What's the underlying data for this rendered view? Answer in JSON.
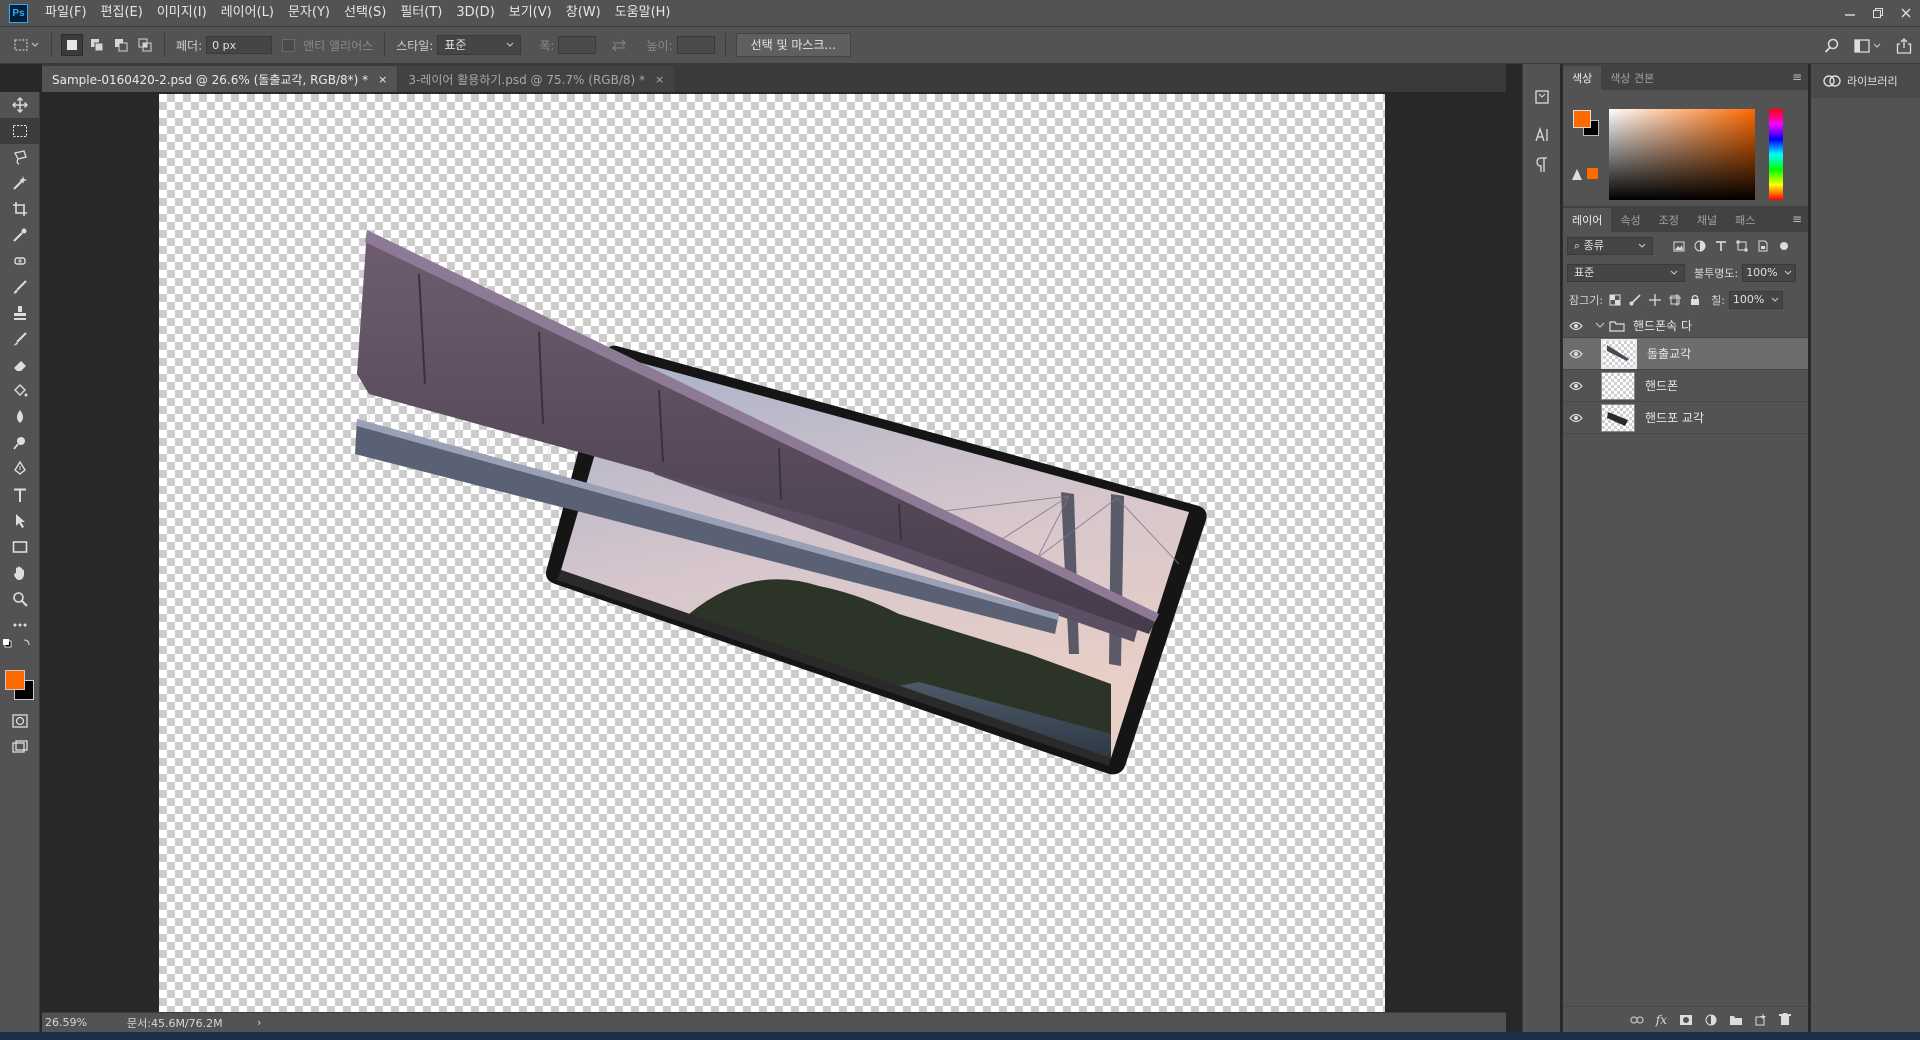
{
  "app": {
    "logo": "Ps"
  },
  "menu": [
    "파일(F)",
    "편집(E)",
    "이미지(I)",
    "레이어(L)",
    "문자(Y)",
    "선택(S)",
    "필터(T)",
    "3D(D)",
    "보기(V)",
    "창(W)",
    "도움말(H)"
  ],
  "options": {
    "feather_label": "페더:",
    "feather_value": "0 px",
    "antialias_label": "앤티 앨리어스",
    "style_label": "스타일:",
    "style_value": "표준",
    "width_label": "폭:",
    "height_label": "높이:",
    "select_mask_button": "선택 및 마스크..."
  },
  "tabs": [
    {
      "label": "Sample-0160420-2.psd @ 26.6% (돌출교각, RGB/8*) *",
      "close": "×"
    },
    {
      "label": "3-레이어 활용하기.psd @ 75.7% (RGB/8) *",
      "close": "×"
    }
  ],
  "status": {
    "zoom": "26.59%",
    "doc": "문서:45.6M/76.2M",
    "arrow": "›"
  },
  "color_panel": {
    "tabs": [
      "색상",
      "색상 견본"
    ],
    "foreground": "#ff6a00",
    "background": "#000000"
  },
  "layers_panel": {
    "tabs": [
      "레이어",
      "속성",
      "조정",
      "채널",
      "패스"
    ],
    "filter_label": "종류",
    "blend_mode": "표준",
    "opacity_label": "불투명도:",
    "opacity_value": "100%",
    "lock_label": "잠그기:",
    "fill_label": "칠:",
    "fill_value": "100%",
    "group": {
      "name": "핸드폰속 다"
    },
    "layers": [
      {
        "name": "돌출교각",
        "selected": true
      },
      {
        "name": "핸드폰",
        "selected": false
      },
      {
        "name": "핸드포 교각",
        "selected": false
      }
    ]
  },
  "libraries": {
    "label": "라이브러리"
  },
  "colors": {
    "accent": "#ff6a00",
    "ui_bg": "#535353",
    "canvas_bg": "#282828"
  }
}
